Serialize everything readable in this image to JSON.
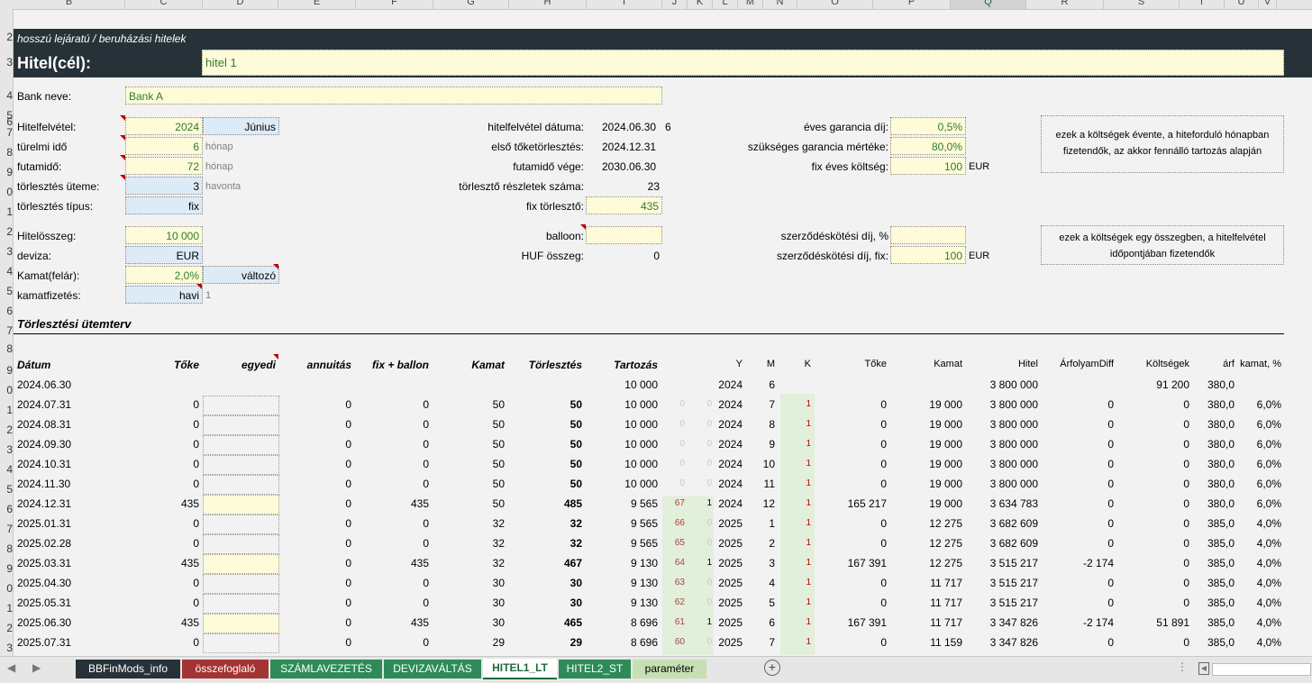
{
  "columns": [
    {
      "l": "B",
      "w": 124
    },
    {
      "l": "C",
      "w": 86
    },
    {
      "l": "D",
      "w": 84
    },
    {
      "l": "E",
      "w": 86
    },
    {
      "l": "F",
      "w": 86
    },
    {
      "l": "G",
      "w": 84
    },
    {
      "l": "H",
      "w": 86
    },
    {
      "l": "I",
      "w": 84
    },
    {
      "l": "J",
      "w": 28
    },
    {
      "l": "K",
      "w": 28
    },
    {
      "l": "L",
      "w": 28
    },
    {
      "l": "M",
      "w": 28
    },
    {
      "l": "N",
      "w": 38
    },
    {
      "l": "O",
      "w": 84
    },
    {
      "l": "P",
      "w": 86
    },
    {
      "l": "Q",
      "w": 84
    },
    {
      "l": "R",
      "w": 86
    },
    {
      "l": "S",
      "w": 84
    },
    {
      "l": "T",
      "w": 50
    },
    {
      "l": "U",
      "w": 38
    },
    {
      "l": "V",
      "w": 20
    }
  ],
  "selected_column": "Q",
  "row_numbers": [
    "2",
    "3",
    "4",
    "5",
    "6",
    "7",
    "8",
    "9",
    "0",
    "1",
    "2",
    "3",
    "4",
    "5",
    "6",
    "7",
    "8",
    "9",
    "0",
    "1",
    "2",
    "3",
    "4",
    "5",
    "6",
    "7",
    "8",
    "9",
    "0",
    "1",
    "2",
    "3",
    "4"
  ],
  "header": {
    "subtitle": "hosszú lejáratú / beruházási hitelek",
    "title_label": "Hitel(cél):",
    "title_value": "hitel 1"
  },
  "bank": {
    "label": "Bank neve:",
    "value": "Bank A"
  },
  "params": {
    "hitelfelvetel": {
      "label": "Hitelfelvétel:",
      "year": "2024",
      "month": "Június"
    },
    "turelmi": {
      "label": "türelmi idő",
      "value": "6",
      "unit": "hónap"
    },
    "futamido": {
      "label": "futamidő:",
      "value": "72",
      "unit": "hónap"
    },
    "utem": {
      "label": "törlesztés üteme:",
      "value": "3",
      "unit": "havonta"
    },
    "tipus": {
      "label": "törlesztés típus:",
      "value": "fix"
    },
    "osszeg": {
      "label": "Hitelösszeg:",
      "value": "10 000"
    },
    "deviza": {
      "label": "deviza:",
      "value": "EUR"
    },
    "kamat": {
      "label": "Kamat(felár):",
      "value": "2,0%",
      "type": "változó"
    },
    "kamatfizetes": {
      "label": "kamatfizetés:",
      "value": "havi",
      "extra": "1"
    }
  },
  "dates": {
    "felvetel_datum": {
      "label": "hitelfelvétel dátuma:",
      "value": "2024.06.30",
      "extra": "6"
    },
    "elso_torles": {
      "label": "első tőketörlesztés:",
      "value": "2024.12.31"
    },
    "futamido_vege": {
      "label": "futamidő vége:",
      "value": "2030.06.30"
    },
    "reszletek": {
      "label": "törlesztő részletek száma:",
      "value": "23"
    },
    "fix_torleszto": {
      "label": "fix törlesztő:",
      "value": "435"
    },
    "balloon": {
      "label": "balloon:",
      "value": ""
    },
    "huf": {
      "label": "HUF összeg:",
      "value": "0"
    }
  },
  "costs": {
    "garancia_dij": {
      "label": "éves garancia díj:",
      "value": "0,5%"
    },
    "garancia_mertek": {
      "label": "szükséges garancia mértéke:",
      "value": "80,0%"
    },
    "fix_eves": {
      "label": "fix éves költség:",
      "value": "100",
      "unit": "EUR"
    },
    "szerz_pct": {
      "label": "szerződéskötési díj, %",
      "value": ""
    },
    "szerz_fix": {
      "label": "szerződéskötési díj, fix:",
      "value": "100",
      "unit": "EUR"
    },
    "note1": "ezek a költségek évente, a hiteforduló hónapban fizetendők, az akkor fennálló tartozás alapján",
    "note2": "ezek a költségek egy összegben, a hitelfelvétel időpontjában fizetendők"
  },
  "schedule": {
    "title": "Törlesztési ütemterv",
    "headers": [
      "Dátum",
      "Tőke",
      "egyedi",
      "annuitás",
      "fix + ballon",
      "Kamat",
      "Törlesztés",
      "Tartozás"
    ],
    "right_headers": [
      "Y",
      "M",
      "K",
      "Tőke",
      "Kamat",
      "Hitel",
      "ÁrfolyamDiff",
      "Költségek",
      "árf",
      "kamat, %"
    ],
    "rows": [
      [
        "2024.06.30",
        "",
        "",
        "",
        "",
        "",
        "",
        "10 000",
        "",
        "",
        "2024",
        "6",
        "",
        "",
        "",
        "3 800 000",
        "",
        "91 200",
        "380,0",
        ""
      ],
      [
        "2024.07.31",
        "0",
        "",
        "0",
        "0",
        "50",
        "50",
        "10 000",
        "0",
        "0",
        "2024",
        "7",
        "1",
        "0",
        "19 000",
        "3 800 000",
        "0",
        "0",
        "380,0",
        "6,0%"
      ],
      [
        "2024.08.31",
        "0",
        "",
        "0",
        "0",
        "50",
        "50",
        "10 000",
        "0",
        "0",
        "2024",
        "8",
        "1",
        "0",
        "19 000",
        "3 800 000",
        "0",
        "0",
        "380,0",
        "6,0%"
      ],
      [
        "2024.09.30",
        "0",
        "",
        "0",
        "0",
        "50",
        "50",
        "10 000",
        "0",
        "0",
        "2024",
        "9",
        "1",
        "0",
        "19 000",
        "3 800 000",
        "0",
        "0",
        "380,0",
        "6,0%"
      ],
      [
        "2024.10.31",
        "0",
        "",
        "0",
        "0",
        "50",
        "50",
        "10 000",
        "0",
        "0",
        "2024",
        "10",
        "1",
        "0",
        "19 000",
        "3 800 000",
        "0",
        "0",
        "380,0",
        "6,0%"
      ],
      [
        "2024.11.30",
        "0",
        "",
        "0",
        "0",
        "50",
        "50",
        "10 000",
        "0",
        "0",
        "2024",
        "11",
        "1",
        "0",
        "19 000",
        "3 800 000",
        "0",
        "0",
        "380,0",
        "6,0%"
      ],
      [
        "2024.12.31",
        "435",
        "",
        "0",
        "435",
        "50",
        "485",
        "9 565",
        "67",
        "1",
        "2024",
        "12",
        "1",
        "165 217",
        "19 000",
        "3 634 783",
        "0",
        "0",
        "380,0",
        "6,0%"
      ],
      [
        "2025.01.31",
        "0",
        "",
        "0",
        "0",
        "32",
        "32",
        "9 565",
        "66",
        "0",
        "2025",
        "1",
        "1",
        "0",
        "12 275",
        "3 682 609",
        "0",
        "0",
        "385,0",
        "4,0%"
      ],
      [
        "2025.02.28",
        "0",
        "",
        "0",
        "0",
        "32",
        "32",
        "9 565",
        "65",
        "0",
        "2025",
        "2",
        "1",
        "0",
        "12 275",
        "3 682 609",
        "0",
        "0",
        "385,0",
        "4,0%"
      ],
      [
        "2025.03.31",
        "435",
        "",
        "0",
        "435",
        "32",
        "467",
        "9 130",
        "64",
        "1",
        "2025",
        "3",
        "1",
        "167 391",
        "12 275",
        "3 515 217",
        "-2 174",
        "0",
        "385,0",
        "4,0%"
      ],
      [
        "2025.04.30",
        "0",
        "",
        "0",
        "0",
        "30",
        "30",
        "9 130",
        "63",
        "0",
        "2025",
        "4",
        "1",
        "0",
        "11 717",
        "3 515 217",
        "0",
        "0",
        "385,0",
        "4,0%"
      ],
      [
        "2025.05.31",
        "0",
        "",
        "0",
        "0",
        "30",
        "30",
        "9 130",
        "62",
        "0",
        "2025",
        "5",
        "1",
        "0",
        "11 717",
        "3 515 217",
        "0",
        "0",
        "385,0",
        "4,0%"
      ],
      [
        "2025.06.30",
        "435",
        "",
        "0",
        "435",
        "30",
        "465",
        "8 696",
        "61",
        "1",
        "2025",
        "6",
        "1",
        "167 391",
        "11 717",
        "3 347 826",
        "-2 174",
        "51 891",
        "385,0",
        "4,0%"
      ],
      [
        "2025.07.31",
        "0",
        "",
        "0",
        "0",
        "29",
        "29",
        "8 696",
        "60",
        "0",
        "2025",
        "7",
        "1",
        "0",
        "11 159",
        "3 347 826",
        "0",
        "0",
        "385,0",
        "4,0%"
      ]
    ]
  },
  "tabs": [
    {
      "label": "BBFinMods_info",
      "color": "#263238",
      "w": 118
    },
    {
      "label": "összefoglaló",
      "color": "#a33434",
      "w": 98
    },
    {
      "label": "SZÁMLAVEZETÉS",
      "color": "#2e8b57",
      "w": 126
    },
    {
      "label": "DEVIZAVÁLTÁS",
      "color": "#2e8b57",
      "w": 110
    },
    {
      "label": "HITEL1_LT",
      "color": "#ffffff",
      "w": 84,
      "active": true
    },
    {
      "label": "HITEL2_ST",
      "color": "#2e8b57",
      "w": 82
    },
    {
      "label": "paraméter",
      "color": "#c6e0b4",
      "w": 84
    }
  ],
  "icons": {
    "add_sheet": "plus-circle-icon",
    "nav_left": "chevron-left-icon",
    "nav_right": "chevron-right-icon"
  }
}
